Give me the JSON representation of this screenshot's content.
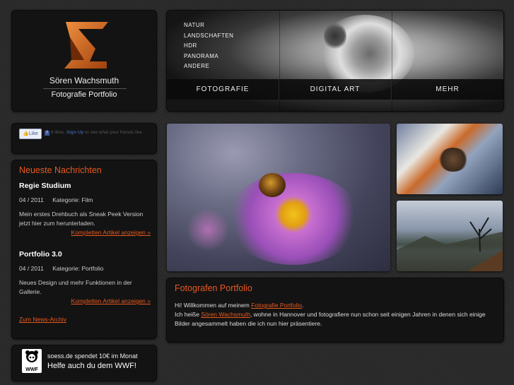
{
  "header": {
    "name": "Sören Wachsmuth",
    "subtitle": "Fotografie Portfolio"
  },
  "nav": {
    "sub_items": [
      "NATUR",
      "LANDSCHAFTEN",
      "HDR",
      "PANORAMA",
      "ANDERE"
    ],
    "main_items": [
      "FOTOGRAFIE",
      "DIGITAL ART",
      "MEHR"
    ]
  },
  "facebook": {
    "like_label": "Like",
    "text_prefix": "6 likes.",
    "signup": "Sign Up",
    "text_suffix": "to see what your friends like."
  },
  "news": {
    "heading": "Neueste Nachrichten",
    "articles": [
      {
        "title": "Regie Studium",
        "date": "04 / 2011",
        "category": "Kategorie: Film",
        "text": "Mein erstes Drehbuch als Sneak Peek Version jetzt hier zum herunterladen.",
        "link": "Kompletten Artikel anzeigen »"
      },
      {
        "title": "Portfolio 3.0",
        "date": "04 / 2011",
        "category": "Kategorie: Portfolio",
        "text": "Neues Design und mehr Funktionen in der Gallerie.",
        "link": "Kompletten Artikel anzeigen »"
      }
    ],
    "archive_link": "Zum News-Archiv"
  },
  "wwf": {
    "logo_text": "WWF",
    "line1": "soess.de spendet 10€ im Monat",
    "line2": "Helfe auch du dem WWF!"
  },
  "welcome": {
    "heading": "Fotografen Portfolio",
    "greeting": "Hi! Willkommen auf meinem",
    "greeting_link": "Fotografie Portfolio",
    "greeting_end": ".",
    "intro": "Ich heiße",
    "name_link": "Sören Wachsmuth",
    "rest": ", wohne in Hannover und fotografiere nun schon seit einigen Jahren in denen sich einige Bilder angesammelt haben die ich nun hier präsentiere."
  },
  "colors": {
    "accent": "#e8591e",
    "panel": "#131313",
    "background": "#2b2b2b"
  }
}
